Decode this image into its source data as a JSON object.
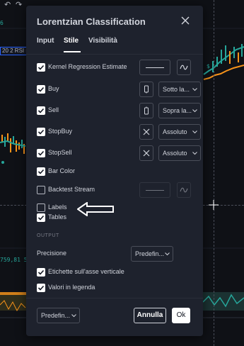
{
  "background": {
    "toolbar": {
      "undo_icon": "undo-icon",
      "redo_icon": "redo-icon"
    },
    "badge_text": "20 2 RSI 5",
    "readout_text": "759,81 5, %",
    "left_value": "6"
  },
  "dialog": {
    "title": "Lorentzian Classification",
    "close_icon": "close-icon",
    "tabs": [
      {
        "label": "Input",
        "active": false
      },
      {
        "label": "Stile",
        "active": true
      },
      {
        "label": "Visibilità",
        "active": false
      }
    ],
    "style_rows": [
      {
        "label": "Kernel Regression Estimate",
        "checked": true
      },
      {
        "label": "Buy",
        "checked": true,
        "select": "Sotto la..."
      },
      {
        "label": "Sell",
        "checked": true,
        "select": "Sopra la..."
      },
      {
        "label": "StopBuy",
        "checked": true,
        "select": "Assoluto"
      },
      {
        "label": "StopSell",
        "checked": true,
        "select": "Assoluto"
      },
      {
        "label": "Bar Color",
        "checked": true
      },
      {
        "label": "Backtest Stream",
        "checked": false
      },
      {
        "label": "Labels",
        "checked": false
      },
      {
        "label": "Tables",
        "checked": true
      }
    ],
    "output": {
      "section_title": "OUTPUT",
      "precision_label": "Precisione",
      "precision_value": "Predefin...",
      "axis_labels": {
        "label": "Etichette sull'asse verticale",
        "checked": true
      },
      "legend_values": {
        "label": "Valori in legenda",
        "checked": true
      }
    },
    "footer": {
      "template_value": "Predefin...",
      "cancel_label": "Annulla",
      "ok_label": "Ok"
    }
  },
  "colors": {
    "dialog_bg": "#1e222d",
    "page_bg": "#131722",
    "text": "#d1d4dc",
    "accent_green": "#26a69a",
    "accent_orange": "#f7931a"
  },
  "annotation": {
    "arrow": "left-arrow-icon"
  }
}
